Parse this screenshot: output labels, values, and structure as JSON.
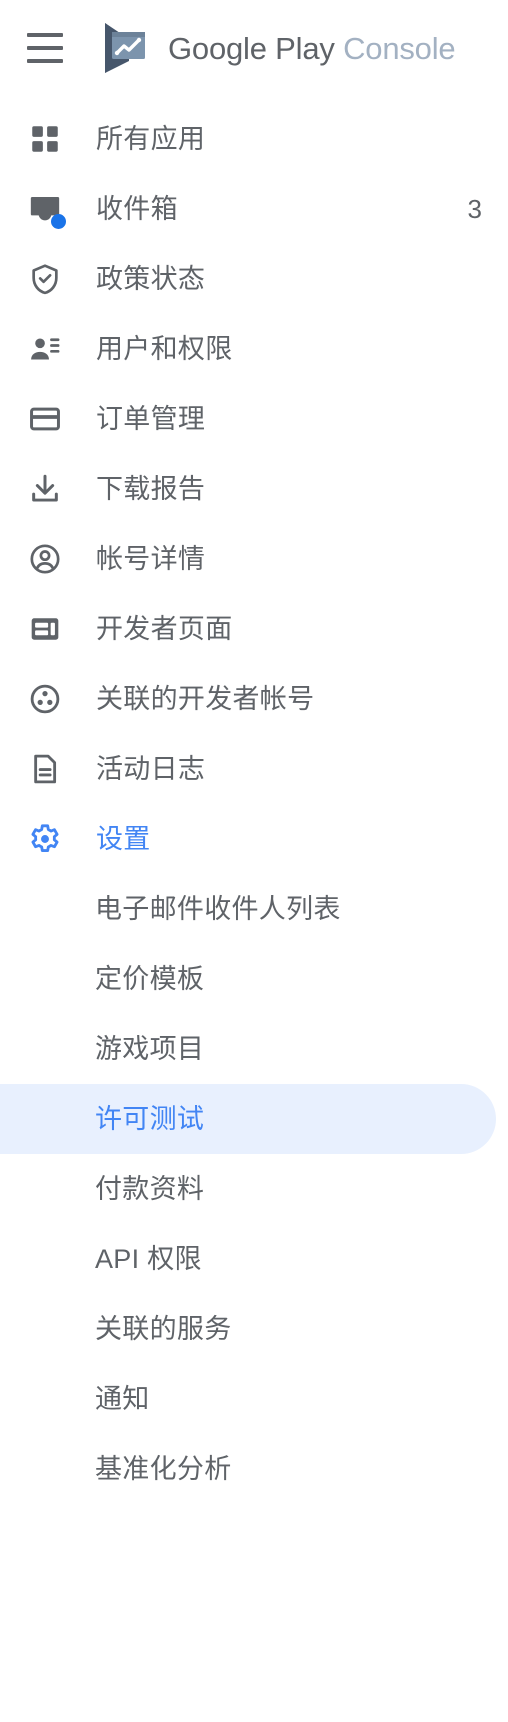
{
  "header": {
    "menu_icon": "hamburger-menu-icon",
    "logo_icon": "google-play-console-logo",
    "brand_primary": "Google Play",
    "brand_secondary": "Console"
  },
  "colors": {
    "accent_blue": "#4285f4",
    "badge_blue": "#1a73e8",
    "selected_bg": "#e8f0fe",
    "text_gray": "#5f6368",
    "console_gray": "#a3b1c2"
  },
  "nav": {
    "items": [
      {
        "label": "所有应用",
        "icon": "apps-grid-icon",
        "count": ""
      },
      {
        "label": "收件箱",
        "icon": "inbox-icon",
        "count": "3"
      },
      {
        "label": "政策状态",
        "icon": "shield-check-icon",
        "count": ""
      },
      {
        "label": "用户和权限",
        "icon": "person-permissions-icon",
        "count": ""
      },
      {
        "label": "订单管理",
        "icon": "credit-card-icon",
        "count": ""
      },
      {
        "label": "下载报告",
        "icon": "download-icon",
        "count": ""
      },
      {
        "label": "帐号详情",
        "icon": "account-circle-icon",
        "count": ""
      },
      {
        "label": "开发者页面",
        "icon": "web-layout-icon",
        "count": ""
      },
      {
        "label": "关联的开发者帐号",
        "icon": "linked-accounts-icon",
        "count": ""
      },
      {
        "label": "活动日志",
        "icon": "document-lines-icon",
        "count": ""
      },
      {
        "label": "设置",
        "icon": "gear-icon",
        "count": "",
        "active": true
      }
    ],
    "sub_items": [
      {
        "label": "电子邮件收件人列表",
        "selected": false
      },
      {
        "label": "定价模板",
        "selected": false
      },
      {
        "label": "游戏项目",
        "selected": false
      },
      {
        "label": "许可测试",
        "selected": true
      },
      {
        "label": "付款资料",
        "selected": false
      },
      {
        "label": "API 权限",
        "selected": false
      },
      {
        "label": "关联的服务",
        "selected": false
      },
      {
        "label": "通知",
        "selected": false
      },
      {
        "label": "基准化分析",
        "selected": false
      }
    ]
  }
}
